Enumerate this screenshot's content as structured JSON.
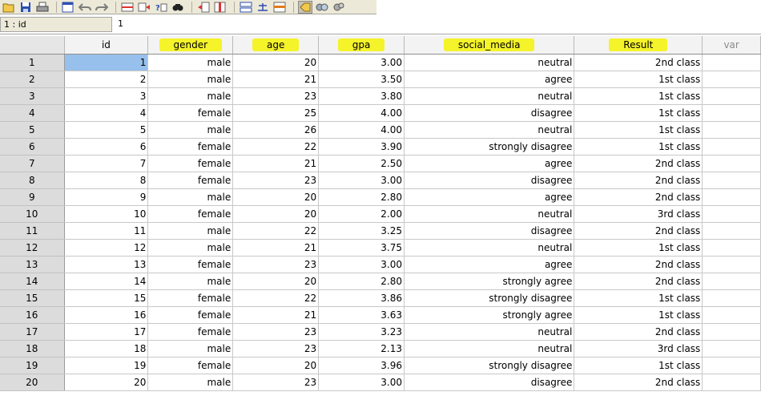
{
  "cell_editor": {
    "reference": "1 : id",
    "value": "1"
  },
  "toolbar": {
    "icons": [
      "open-icon",
      "save-icon",
      "print-icon",
      "dialog-recall-icon",
      "undo-icon",
      "redo-icon",
      "goto-case-icon",
      "insert-variable-icon",
      "variables-icon",
      "find-icon",
      "insert-cases-icon",
      "insert-variable-col-icon",
      "split-file-icon",
      "weight-cases-icon",
      "select-cases-icon",
      "value-labels-icon",
      "use-sets-icon",
      "show-all-icon"
    ]
  },
  "columns": [
    "id",
    "gender",
    "age",
    "gpa",
    "social_media",
    "Result",
    "var"
  ],
  "highlighted_columns": [
    "gender",
    "age",
    "gpa",
    "social_media",
    "Result"
  ],
  "highlight_color": "#f5f32a",
  "selected_color": "#98c0ec",
  "rows": [
    [
      "1",
      "male",
      "20",
      "3.00",
      "neutral",
      "2nd class"
    ],
    [
      "2",
      "male",
      "21",
      "3.50",
      "agree",
      "1st class"
    ],
    [
      "3",
      "male",
      "23",
      "3.80",
      "neutral",
      "1st class"
    ],
    [
      "4",
      "female",
      "25",
      "4.00",
      "disagree",
      "1st class"
    ],
    [
      "5",
      "male",
      "26",
      "4.00",
      "neutral",
      "1st class"
    ],
    [
      "6",
      "female",
      "22",
      "3.90",
      "strongly disagree",
      "1st class"
    ],
    [
      "7",
      "female",
      "21",
      "2.50",
      "agree",
      "2nd class"
    ],
    [
      "8",
      "female",
      "23",
      "3.00",
      "disagree",
      "2nd class"
    ],
    [
      "9",
      "male",
      "20",
      "2.80",
      "agree",
      "2nd class"
    ],
    [
      "10",
      "female",
      "20",
      "2.00",
      "neutral",
      "3rd class"
    ],
    [
      "11",
      "male",
      "22",
      "3.25",
      "disagree",
      "2nd class"
    ],
    [
      "12",
      "male",
      "21",
      "3.75",
      "neutral",
      "1st class"
    ],
    [
      "13",
      "female",
      "23",
      "3.00",
      "agree",
      "2nd class"
    ],
    [
      "14",
      "male",
      "20",
      "2.80",
      "strongly agree",
      "2nd class"
    ],
    [
      "15",
      "female",
      "22",
      "3.86",
      "strongly disagree",
      "1st class"
    ],
    [
      "16",
      "female",
      "21",
      "3.63",
      "strongly agree",
      "1st class"
    ],
    [
      "17",
      "female",
      "23",
      "3.23",
      "neutral",
      "2nd class"
    ],
    [
      "18",
      "male",
      "23",
      "2.13",
      "neutral",
      "3rd class"
    ],
    [
      "19",
      "female",
      "20",
      "3.96",
      "strongly disagree",
      "1st class"
    ],
    [
      "20",
      "male",
      "23",
      "3.00",
      "disagree",
      "2nd class"
    ]
  ]
}
